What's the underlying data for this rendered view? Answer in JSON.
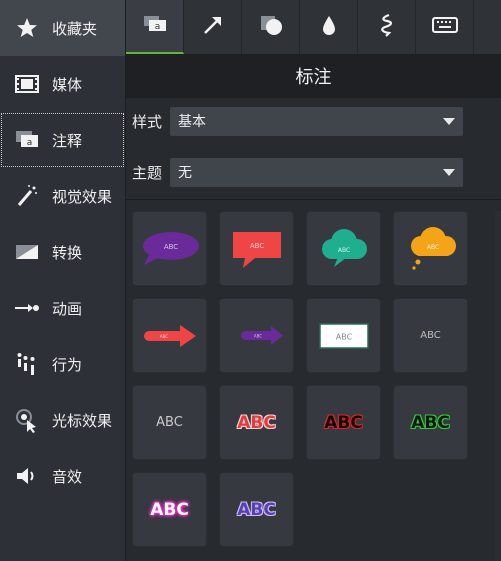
{
  "sidebar": {
    "items": [
      {
        "label": "收藏夹",
        "icon": "star-icon"
      },
      {
        "label": "媒体",
        "icon": "film-icon"
      },
      {
        "label": "注释",
        "icon": "annotation-icon"
      },
      {
        "label": "视觉效果",
        "icon": "magic-wand-icon"
      },
      {
        "label": "转换",
        "icon": "transition-icon"
      },
      {
        "label": "动画",
        "icon": "animation-icon"
      },
      {
        "label": "行为",
        "icon": "behavior-icon"
      },
      {
        "label": "光标效果",
        "icon": "cursor-effect-icon"
      },
      {
        "label": "音效",
        "icon": "speaker-icon"
      }
    ]
  },
  "tabs": [
    {
      "icon": "callout-tab-icon"
    },
    {
      "icon": "arrow-tab-icon"
    },
    {
      "icon": "shape-tab-icon"
    },
    {
      "icon": "blur-drop-tab-icon"
    },
    {
      "icon": "sketch-motion-tab-icon"
    },
    {
      "icon": "keystroke-tab-icon"
    }
  ],
  "panel": {
    "title": "标注",
    "style_label": "样式",
    "style_value": "基本",
    "theme_label": "主题",
    "theme_value": "无"
  },
  "annotations": {
    "sample_text": "ABC",
    "colors": {
      "purple": "#6a2a9a",
      "red": "#f04545",
      "teal": "#1fae8e",
      "orange": "#f5a418"
    }
  }
}
